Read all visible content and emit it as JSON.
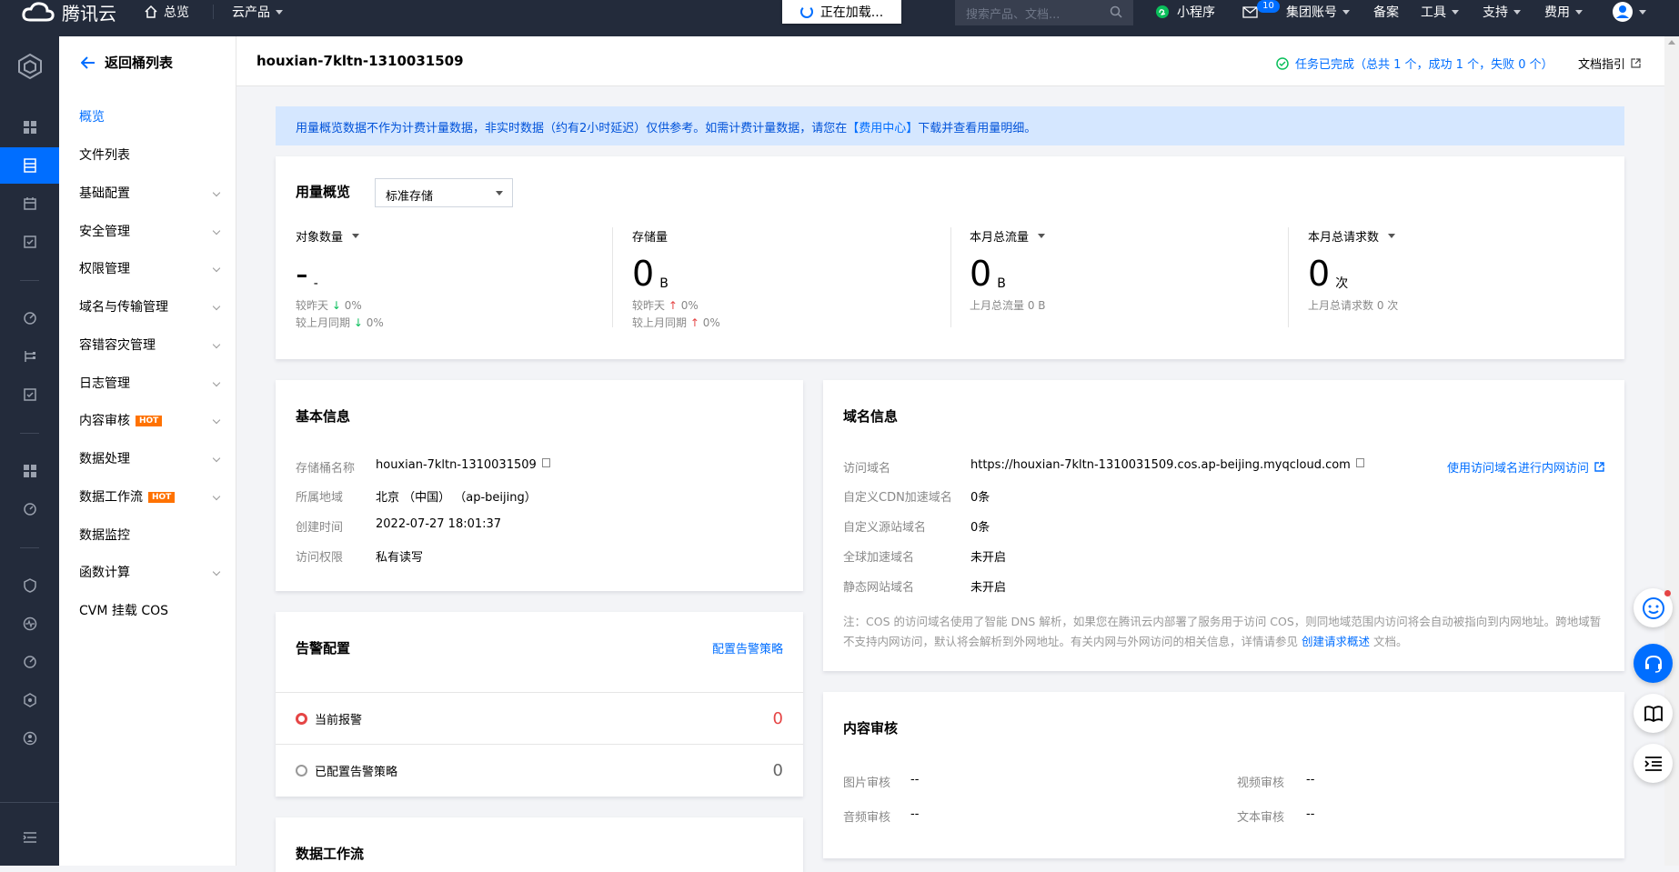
{
  "topbar": {
    "brand": "腾讯云",
    "overview": "总览",
    "products": "云产品",
    "loading": "正在加载...",
    "search_placeholder": "搜索产品、文档...",
    "miniprogram": "小程序",
    "mail_count": "10",
    "group_account": "集团账号",
    "record": "备案",
    "tools": "工具",
    "support": "支持",
    "billing": "费用"
  },
  "sidebar": {
    "back": "返回桶列表",
    "items": [
      {
        "label": "概览",
        "selected": true
      },
      {
        "label": "文件列表"
      },
      {
        "label": "基础配置"
      },
      {
        "label": "安全管理"
      },
      {
        "label": "权限管理"
      },
      {
        "label": "域名与传输管理"
      },
      {
        "label": "容错容灾管理"
      },
      {
        "label": "日志管理"
      },
      {
        "label": "内容审核",
        "badge": "HOT"
      },
      {
        "label": "数据处理"
      },
      {
        "label": "数据工作流",
        "badge": "HOT"
      },
      {
        "label": "数据监控"
      },
      {
        "label": "函数计算"
      },
      {
        "label": "CVM 挂载 COS"
      }
    ]
  },
  "header": {
    "bucket": "houxian-7kltn-1310031509",
    "task_status": "任务已完成（总共 1 个，成功 1 个，失败 0 个）",
    "doc_guide": "文档指引"
  },
  "notice": {
    "text_before": "用量概览数据不作为计费计量数据，非实时数据（约有2小时延迟）仅供参考。如需计费计量数据，请您在",
    "link": "【费用中心】",
    "text_after": "下载并查看用量明细。"
  },
  "usage": {
    "title": "用量概览",
    "storage_class": "标准存储",
    "stats": [
      {
        "label": "对象数量",
        "value": "-",
        "unit": "-",
        "line1_label": "较昨天",
        "line1_value": "0%",
        "line2_label": "较上月同期",
        "line2_value": "0%"
      },
      {
        "label": "存储量",
        "value": "0",
        "unit": "B",
        "line1_label": "较昨天",
        "line1_value": "0%",
        "line2_label": "较上月同期",
        "line2_value": "0%"
      },
      {
        "label": "本月总流量",
        "value": "0",
        "unit": "B",
        "line1_label": "上月总流量 0 B"
      },
      {
        "label": "本月总请求数",
        "value": "0",
        "unit": "次",
        "line1_label": "上月总请求数 0 次"
      }
    ]
  },
  "basic": {
    "title": "基本信息",
    "rows": [
      {
        "k": "存储桶名称",
        "v": "houxian-7kltn-1310031509"
      },
      {
        "k": "所属地域",
        "v": "北京 （中国） （ap-beijing）"
      },
      {
        "k": "创建时间",
        "v": "2022-07-27 18:01:37"
      },
      {
        "k": "访问权限",
        "v": "私有读写"
      }
    ]
  },
  "alarm": {
    "title": "告警配置",
    "action": "配置告警策略",
    "rows": [
      {
        "label": "当前报警",
        "value": "0"
      },
      {
        "label": "已配置告警策略",
        "value": "0"
      }
    ]
  },
  "workflow": {
    "title": "数据工作流"
  },
  "domain": {
    "title": "域名信息",
    "rows": [
      {
        "k": "访问域名",
        "v": "https://houxian-7kltn-1310031509.cos.ap-beijing.myqcloud.com"
      },
      {
        "k": "自定义CDN加速域名",
        "v": "0条"
      },
      {
        "k": "自定义源站域名",
        "v": "0条"
      },
      {
        "k": "全球加速域名",
        "v": "未开启"
      },
      {
        "k": "静态网站域名",
        "v": "未开启"
      }
    ],
    "intranet_link": "使用访问域名进行内网访问",
    "note_before": "注：COS 的访问域名使用了智能 DNS 解析，如果您在腾讯云内部署了服务用于访问 COS，则同地域范围内访问将会自动被指向到内网地址。跨地域暂不支持内网访问，默认将会解析到外网地址。有关内网与外网访问的相关信息，详情请参见",
    "note_link": "创建请求概述",
    "note_after": "文档。"
  },
  "audit": {
    "title": "内容审核",
    "items": [
      {
        "k": "图片审核",
        "v": "--"
      },
      {
        "k": "视频审核",
        "v": "--"
      },
      {
        "k": "音频审核",
        "v": "--"
      },
      {
        "k": "文本审核",
        "v": "--"
      }
    ]
  },
  "colors": {
    "accent": "#006eff",
    "topbar": "#232b3b",
    "hot": "#ff7200",
    "alarm": "#e54545"
  }
}
